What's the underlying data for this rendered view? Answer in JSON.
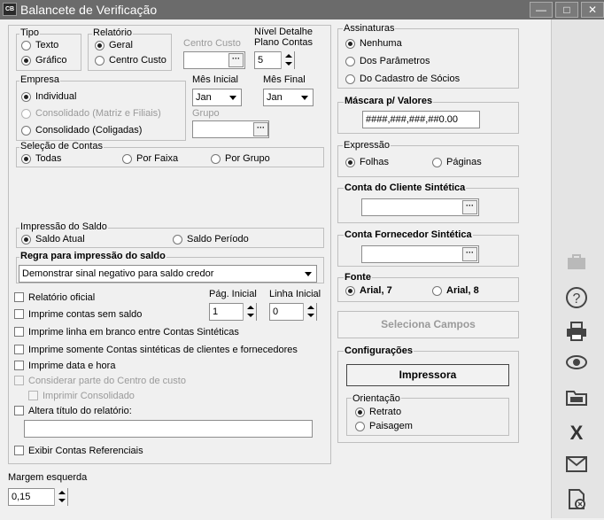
{
  "window": {
    "title": "Balancete de Verificação",
    "logo": "CB"
  },
  "tipo": {
    "legend": "Tipo",
    "opt1": "Texto",
    "opt2": "Gráfico"
  },
  "relatorio": {
    "legend": "Relatório",
    "opt1": "Geral",
    "opt2": "Centro Custo"
  },
  "centro_custo": {
    "label": "Centro Custo",
    "value": ""
  },
  "nivel": {
    "label1": "Nível Detalhe",
    "label2": "Plano Contas",
    "value": "5"
  },
  "empresa": {
    "legend": "Empresa",
    "opt1": "Individual",
    "opt2": "Consolidado (Matriz e Filiais)",
    "opt3": "Consolidado (Coligadas)"
  },
  "mes_inicial": {
    "label": "Mês Inicial",
    "value": "Jan"
  },
  "mes_final": {
    "label": "Mês Final",
    "value": "Jan"
  },
  "grupo": {
    "label": "Grupo",
    "value": ""
  },
  "selecao": {
    "legend": "Seleção de Contas",
    "opt1": "Todas",
    "opt2": "Por Faixa",
    "opt3": "Por Grupo"
  },
  "impressao_saldo": {
    "legend": "Impressão do Saldo",
    "opt1": "Saldo Atual",
    "opt2": "Saldo Período"
  },
  "regra": {
    "legend": "Regra para impressão do saldo",
    "value": "Demonstrar sinal negativo para saldo credor"
  },
  "checks": {
    "relatorio_oficial": "Relatório oficial",
    "sem_saldo": "Imprime contas sem saldo",
    "linha_branco": "Imprime linha em branco entre Contas Sintéticas",
    "somente_sinteticas": "Imprime somente Contas sintéticas  de clientes e fornecedores",
    "data_hora": "Imprime data e hora",
    "parte_centro": "Considerar parte do Centro de custo",
    "consolidado": "Imprimir Consolidado",
    "altera_titulo": "Altera título do relatório:",
    "referenciais": "Exibir Contas Referenciais"
  },
  "pag_inicial": {
    "label": "Pág. Inicial",
    "value": "1"
  },
  "linha_inicial": {
    "label": "Linha Inicial",
    "value": "0"
  },
  "titulo_input": {
    "value": ""
  },
  "margem": {
    "label": "Margem esquerda",
    "value": "0,15"
  },
  "assinaturas": {
    "legend": "Assinaturas",
    "opt1": "Nenhuma",
    "opt2": "Dos Parâmetros",
    "opt3": "Do Cadastro de Sócios"
  },
  "mascara": {
    "legend": "Máscara p/ Valores",
    "value": "####,###,###,##0.00"
  },
  "expressao": {
    "legend": "Expressão",
    "opt1": "Folhas",
    "opt2": "Páginas"
  },
  "conta_cliente": {
    "legend": "Conta do Cliente Sintética",
    "value": ""
  },
  "conta_fornecedor": {
    "legend": "Conta Fornecedor Sintética",
    "value": ""
  },
  "fonte": {
    "legend": "Fonte",
    "opt1": "Arial, 7",
    "opt2": "Arial, 8"
  },
  "seleciona_campos": "Seleciona Campos",
  "configuracoes": {
    "legend": "Configurações",
    "impressora": "Impressora",
    "orientacao": "Orientação",
    "opt1": "Retrato",
    "opt2": "Paisagem"
  },
  "icons": [
    "briefcase-icon",
    "help-icon",
    "printer-icon",
    "preview-icon",
    "folder-icon",
    "excel-icon",
    "email-icon",
    "pdf-icon"
  ]
}
